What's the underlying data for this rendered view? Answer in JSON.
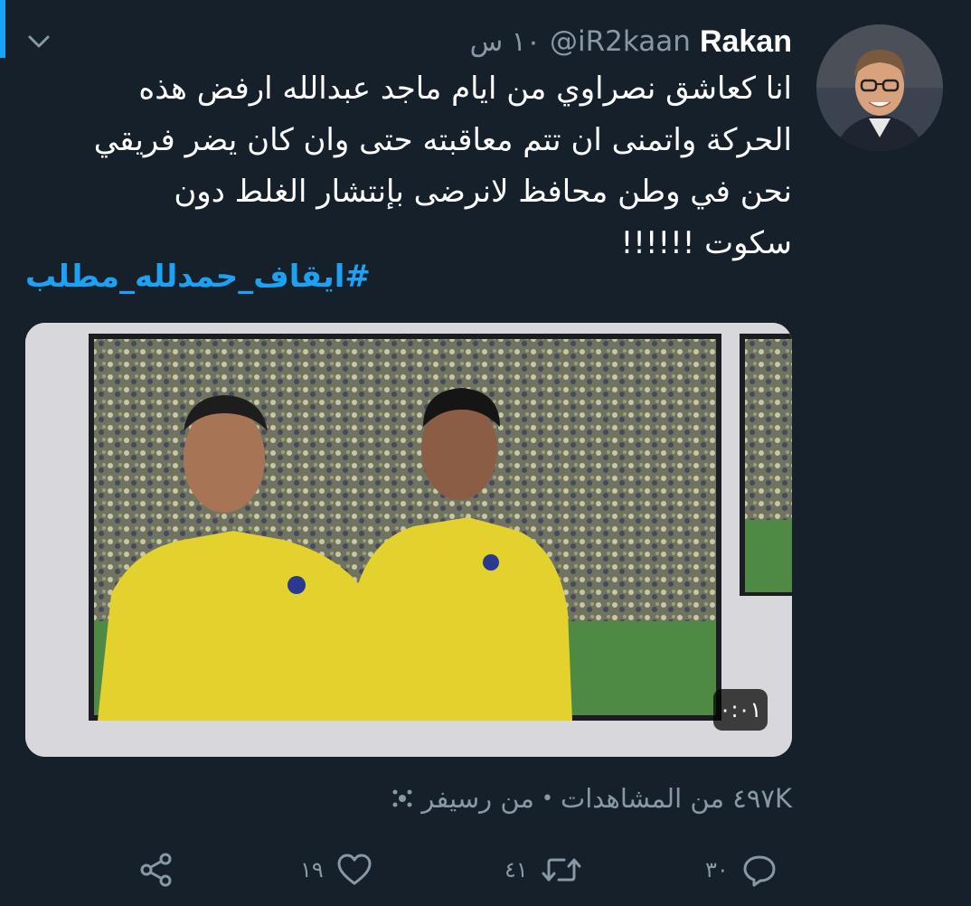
{
  "tweet": {
    "display_name": "Rakan",
    "handle": "@iR2kaan",
    "time": "١٠ س",
    "text_lines": [
      "انا كعاشق نصراوي من ايام ماجد عبدالله ارفض هذه",
      "الحركة واتمنى ان تتم معاقبته حتى وان كان يضر فريقي",
      "نحن في وطن محافظ لانرضى بإنتشار الغلط دون",
      "سكوت !!!!!!"
    ],
    "hashtag": "#ايقاف_حمدلله_مطلب"
  },
  "media": {
    "duration": "٠:٠١"
  },
  "meta": {
    "views": "٤٩٧K من المشاهدات",
    "separator": "•",
    "source": "من رسيفر"
  },
  "actions": {
    "reply_count": "٣٠",
    "retweet_count": "٤١",
    "like_count": "١٩"
  },
  "icons": {
    "chevron": "chevron-down-icon",
    "reply": "reply-icon",
    "retweet": "retweet-icon",
    "like": "heart-icon",
    "share": "share-icon",
    "source": "broadcast-icon"
  },
  "colors": {
    "background": "#15202b",
    "accent": "#1da1f2",
    "secondary_text": "#8899a6",
    "primary_text": "#ffffff"
  }
}
